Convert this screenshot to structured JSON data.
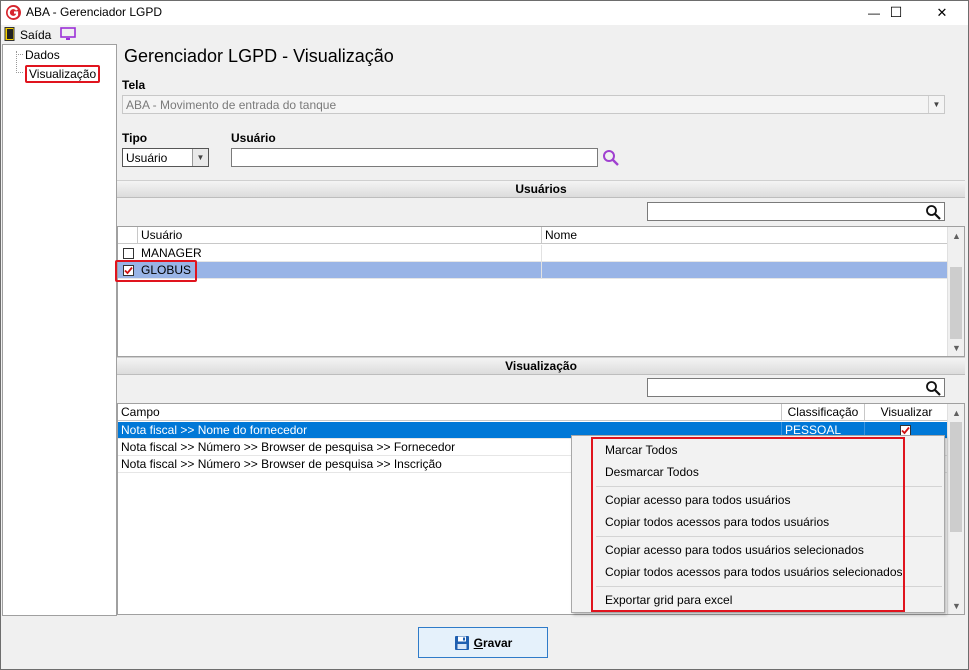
{
  "window": {
    "title": "ABA - Gerenciador LGPD",
    "minimize_glyph": "—",
    "maximize_glyph": "☐",
    "close_glyph": "✕"
  },
  "menubar": {
    "exit_label": "Saída",
    "exit_icon": "exit-door-icon",
    "monitor_icon": "monitor-icon"
  },
  "tree": {
    "items": [
      {
        "label": "Dados"
      },
      {
        "label": "Visualização"
      }
    ]
  },
  "main": {
    "title": "Gerenciador LGPD - Visualização",
    "tela_label": "Tela",
    "tela_value": "ABA - Movimento de entrada do tanque",
    "tipo_label": "Tipo",
    "tipo_value": "Usuário",
    "usuario_label": "Usuário",
    "usuario_value": ""
  },
  "users_section": {
    "header": "Usuários",
    "search_value": "",
    "columns": [
      "Usuário",
      "Nome"
    ],
    "rows": [
      {
        "checked": false,
        "usuario": "MANAGER",
        "nome": ""
      },
      {
        "checked": true,
        "usuario": "GLOBUS",
        "nome": ""
      }
    ]
  },
  "visualization_section": {
    "header": "Visualização",
    "search_value": "",
    "columns": [
      "Campo",
      "Classificação",
      "Visualizar"
    ],
    "rows": [
      {
        "campo": "Nota fiscal >> Nome do fornecedor",
        "classificacao": "PESSOAL",
        "visualizar": true
      },
      {
        "campo": "Nota fiscal >> Número >> Browser de pesquisa >> Fornecedor",
        "classificacao": "",
        "visualizar": false
      },
      {
        "campo": "Nota fiscal >> Número >> Browser de pesquisa >> Inscrição",
        "classificacao": "",
        "visualizar": false
      }
    ]
  },
  "context_menu": {
    "items": [
      {
        "label": "Marcar Todos"
      },
      {
        "label": "Desmarcar Todos"
      },
      {
        "label": "Copiar acesso para todos usuários"
      },
      {
        "label": "Copiar todos acessos para todos usuários"
      },
      {
        "label": "Copiar acesso para todos usuários selecionados"
      },
      {
        "label": "Copiar todos acessos para todos usuários selecionados"
      },
      {
        "label": "Exportar grid para excel"
      }
    ]
  },
  "footer": {
    "save_label_first": "G",
    "save_label_rest": "ravar",
    "save_icon": "floppy-disk-icon"
  },
  "colors": {
    "selection_blue": "#0078d7",
    "selection_light": "#99b4e6",
    "highlight_red": "#e0141e",
    "button_bg": "#e5f1fb",
    "button_border": "#2f7bc9"
  }
}
